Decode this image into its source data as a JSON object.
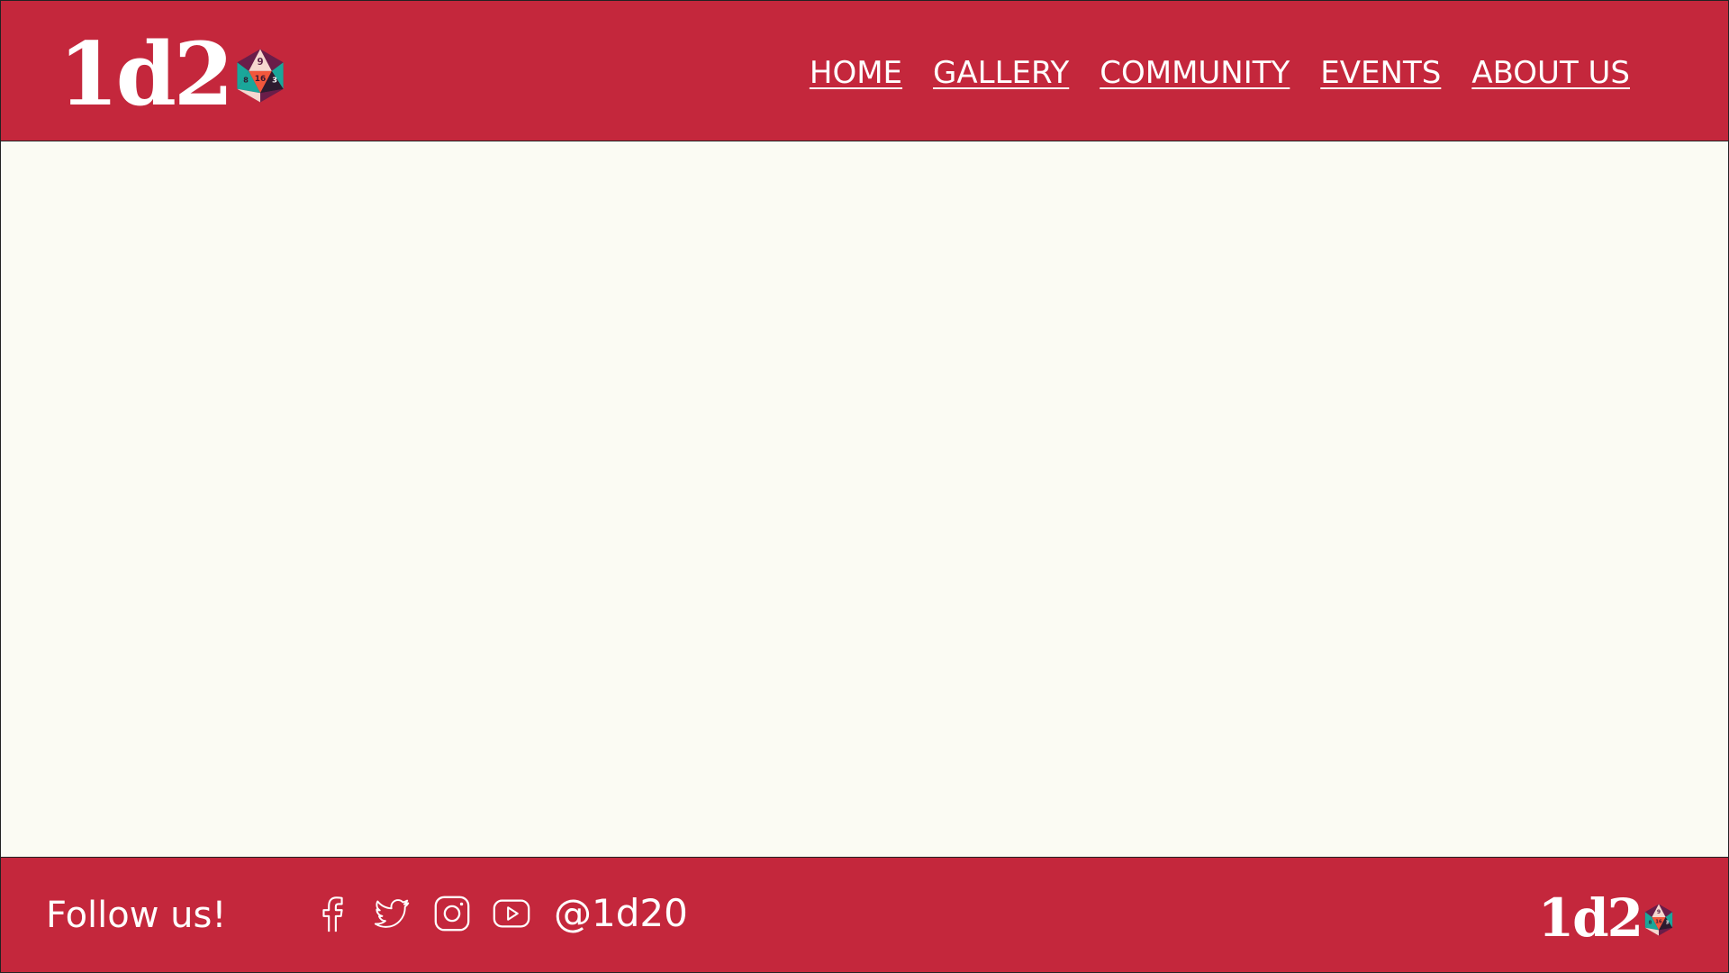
{
  "brand": {
    "logo_text": "1d2",
    "logo_icon": "d20-die-icon",
    "primary_color": "#c4273c",
    "background_color": "#fbfbf3",
    "die_colors": [
      "#f6d7cf",
      "#f2573c",
      "#1aa79a",
      "#6a1d49",
      "#2d1b2f"
    ]
  },
  "header": {
    "nav": [
      {
        "label": "HOME"
      },
      {
        "label": "GALLERY"
      },
      {
        "label": "COMMUNITY"
      },
      {
        "label": "EVENTS"
      },
      {
        "label": "ABOUT US"
      }
    ]
  },
  "main": {},
  "footer": {
    "follow_text": "Follow us!",
    "handle": "@1d20",
    "social_icons": [
      "facebook-icon",
      "twitter-icon",
      "instagram-icon",
      "youtube-icon"
    ]
  }
}
